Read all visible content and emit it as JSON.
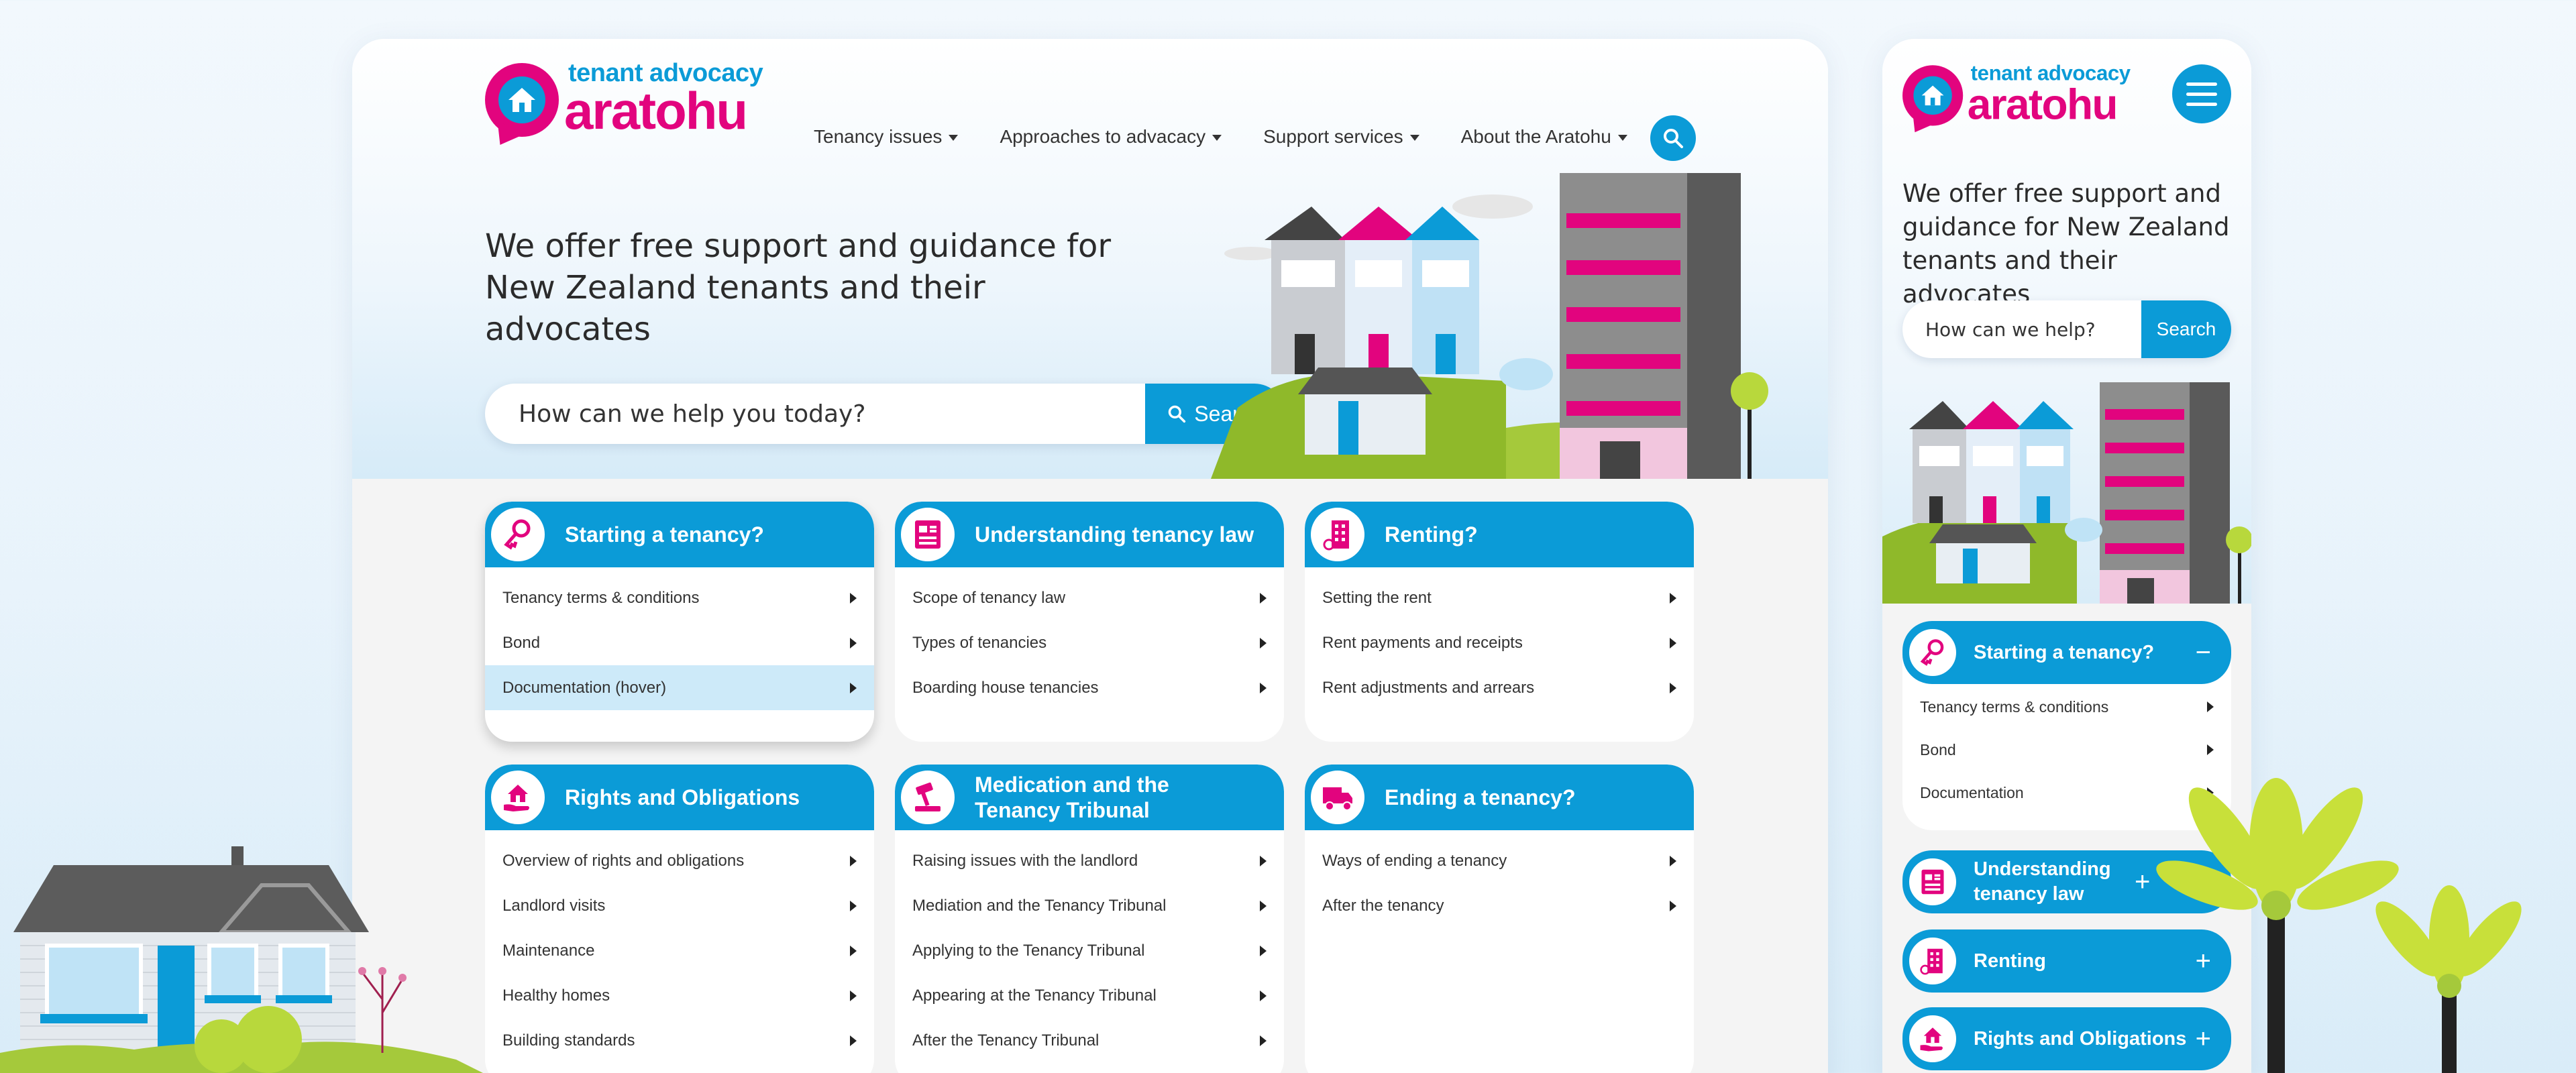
{
  "brand": {
    "line1": "tenant advocacy",
    "line2": "aratohu",
    "pink": "#e2047e",
    "blue": "#0b9bd7"
  },
  "nav": {
    "items": [
      {
        "label": "Tenancy issues"
      },
      {
        "label": "Approaches to advacacy"
      },
      {
        "label": "Support services"
      },
      {
        "label": "About the Aratohu"
      }
    ]
  },
  "hero": {
    "title": "We offer free support and guidance for New Zealand tenants and their advocates",
    "search_placeholder": "How can we help you today?",
    "search_button": "Search"
  },
  "cards": [
    {
      "title": "Starting a tenancy?",
      "icon": "key-icon",
      "rows": [
        "Tenancy terms & conditions",
        "Bond",
        "Documentation (hover)"
      ]
    },
    {
      "title": "Understanding tenancy law",
      "icon": "document-icon",
      "rows": [
        "Scope of tenancy law",
        "Types of tenancies",
        "Boarding house tenancies"
      ]
    },
    {
      "title": "Renting?",
      "icon": "building-icon",
      "rows": [
        "Setting the rent",
        "Rent payments and receipts",
        "Rent adjustments and arrears"
      ]
    },
    {
      "title": "Rights and Obligations",
      "icon": "house-hand-icon",
      "rows": [
        "Overview of rights and obligations",
        "Landlord visits",
        "Maintenance",
        "Healthy homes",
        "Building standards"
      ]
    },
    {
      "title": "Medication and the Tenancy Tribunal",
      "icon": "gavel-icon",
      "rows": [
        "Raising issues with the landlord",
        "Mediation and the Tenancy Tribunal",
        "Applying to the Tenancy Tribunal",
        "Appearing at the Tenancy Tribunal",
        "After the Tenancy Tribunal"
      ]
    },
    {
      "title": "Ending a tenancy?",
      "icon": "truck-icon",
      "rows": [
        "Ways of ending a tenancy",
        "After the tenancy"
      ]
    }
  ],
  "mobile": {
    "title": "We offer free support and guidance for New Zealand tenants and their advocates",
    "search_placeholder": "How can we help?",
    "search_button": "Search",
    "open_accordion": {
      "title": "Starting a tenancy?",
      "sign": "−",
      "rows": [
        "Tenancy terms & conditions",
        "Bond",
        "Documentation"
      ]
    },
    "accordions": [
      {
        "title": "Understanding tenancy law",
        "sign": "+"
      },
      {
        "title": "Renting",
        "sign": "+"
      },
      {
        "title": "Rights and Obligations",
        "sign": "+"
      }
    ]
  }
}
